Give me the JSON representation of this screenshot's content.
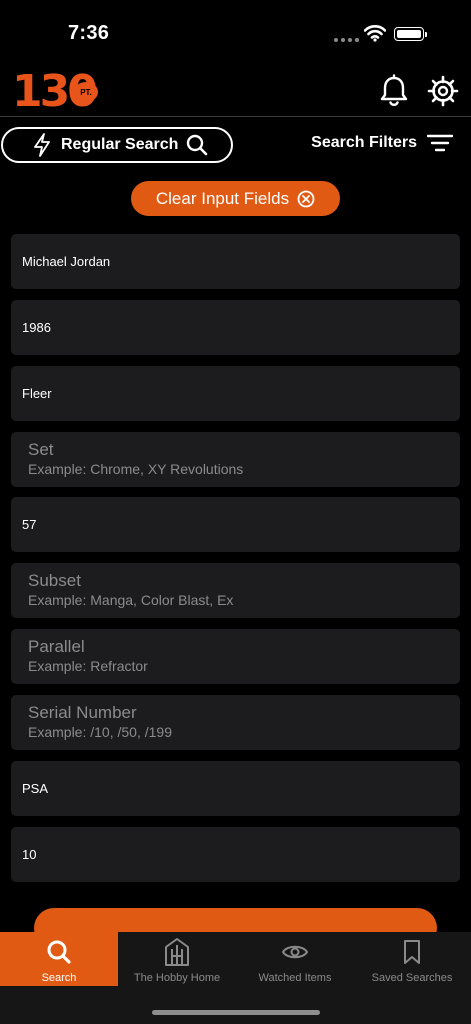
{
  "status": {
    "time": "7:36"
  },
  "header": {
    "logo_number": "130",
    "logo_badge": "PT."
  },
  "search": {
    "regular_label": "Regular Search",
    "filters_label": "Search Filters"
  },
  "clear_button": {
    "label": "Clear Input Fields"
  },
  "fields": [
    {
      "value": "Michael Jordan"
    },
    {
      "value": "1986"
    },
    {
      "value": "Fleer"
    },
    {
      "label": "Set",
      "example": "Example: Chrome, XY Revolutions"
    },
    {
      "value": "57"
    },
    {
      "label": "Subset",
      "example": "Example: Manga, Color Blast, Ex"
    },
    {
      "label": "Parallel",
      "example": "Example: Refractor"
    },
    {
      "label": "Serial Number",
      "example": "Example: /10, /50, /199"
    },
    {
      "value": "PSA"
    },
    {
      "value": "10"
    }
  ],
  "tabs": [
    {
      "label": "Search",
      "icon": "search-icon",
      "active": true
    },
    {
      "label": "The Hobby Home",
      "icon": "hobby-home-icon"
    },
    {
      "label": "Watched Items",
      "icon": "eye-icon"
    },
    {
      "label": "Saved Searches",
      "icon": "bookmark-icon"
    }
  ],
  "colors": {
    "accent": "#e05a14",
    "field_bg": "#1c1c1e",
    "background": "#000000",
    "placeholder": "#8b8b8b"
  }
}
